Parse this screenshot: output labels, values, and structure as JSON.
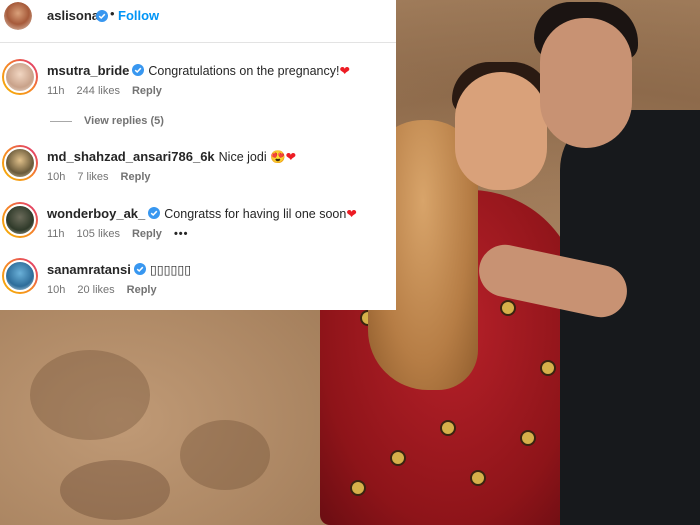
{
  "post": {
    "author": "aslisona",
    "follow_label": "Follow",
    "separator": "•"
  },
  "comments": [
    {
      "username": "msutra_bride",
      "verified": true,
      "text": "Congratulations on the pregnancy!",
      "emoji": "❤",
      "time": "11h",
      "likes": "244 likes",
      "reply_label": "Reply"
    },
    {
      "username": "md_shahzad_ansari786_6k",
      "verified": false,
      "text": "Nice jodi",
      "emoji": "😍❤",
      "time": "10h",
      "likes": "7 likes",
      "reply_label": "Reply"
    },
    {
      "username": "wonderboy_ak_",
      "verified": true,
      "text": "Congratss for having lil one soon",
      "emoji": "❤",
      "time": "11h",
      "likes": "105 likes",
      "reply_label": "Reply",
      "more": "•••"
    },
    {
      "username": "sanamratansi",
      "verified": true,
      "text": "▯▯▯▯▯▯",
      "time": "10h",
      "likes": "20 likes",
      "reply_label": "Reply"
    }
  ],
  "view_replies_label": "View replies (5)",
  "colors": {
    "link_blue": "#0095f6",
    "verified_blue": "#3897f0",
    "heart_red": "#ed1c24",
    "meta_gray": "#737373"
  },
  "icons": [
    "verified-badge-icon",
    "heart-icon",
    "more-options-icon"
  ]
}
